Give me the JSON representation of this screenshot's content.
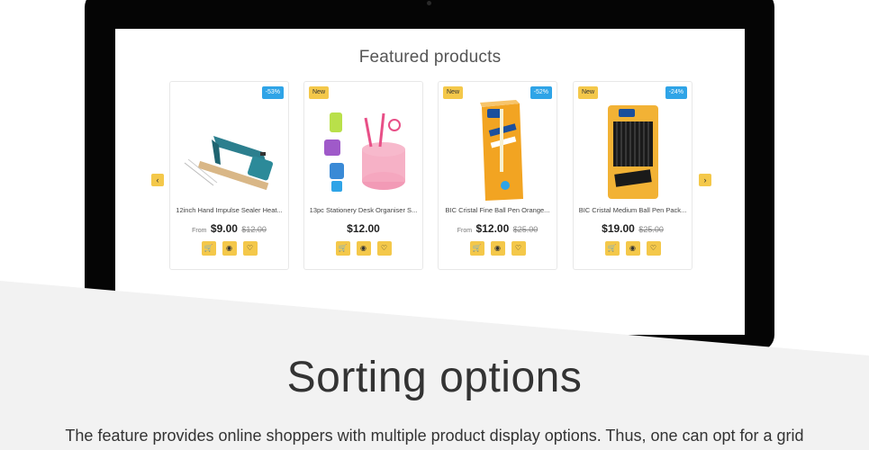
{
  "featured": {
    "title": "Featured products",
    "products": [
      {
        "name": "12inch Hand Impulse Sealer Heat...",
        "badge": "-53%",
        "badge_type": "discount",
        "from": "From",
        "price": "$9.00",
        "old_price": "$12.00",
        "image_icon": "impulse-sealer-icon"
      },
      {
        "name": "13pc Stationery Desk Organiser S...",
        "badge": "New",
        "badge_type": "new",
        "from": "",
        "price": "$12.00",
        "old_price": "",
        "image_icon": "desk-organiser-icon"
      },
      {
        "name": "BIC Cristal Fine Ball Pen Orange...",
        "badge": "New",
        "badge_type": "new",
        "badge2": "-52%",
        "from": "From",
        "price": "$12.00",
        "old_price": "$25.00",
        "image_icon": "pen-box-orange-icon"
      },
      {
        "name": "BIC Cristal Medium Ball Pen Pack...",
        "badge": "New",
        "badge_type": "new",
        "badge2": "-24%",
        "from": "",
        "price": "$19.00",
        "old_price": "$25.00",
        "image_icon": "pen-pack-black-icon"
      }
    ],
    "actions": {
      "cart_icon": "cart-icon",
      "view_icon": "eye-icon",
      "wishlist_icon": "heart-icon"
    },
    "prev_icon": "chevron-left-icon",
    "next_icon": "chevron-right-icon"
  },
  "section": {
    "headline": "Sorting options",
    "description": "The feature provides online shoppers with multiple product display options. Thus, one can opt for a grid"
  },
  "colors": {
    "accent": "#f4c84a",
    "discount": "#2fa4e7",
    "band": "#f2f2f2",
    "laptop": "#050505"
  }
}
